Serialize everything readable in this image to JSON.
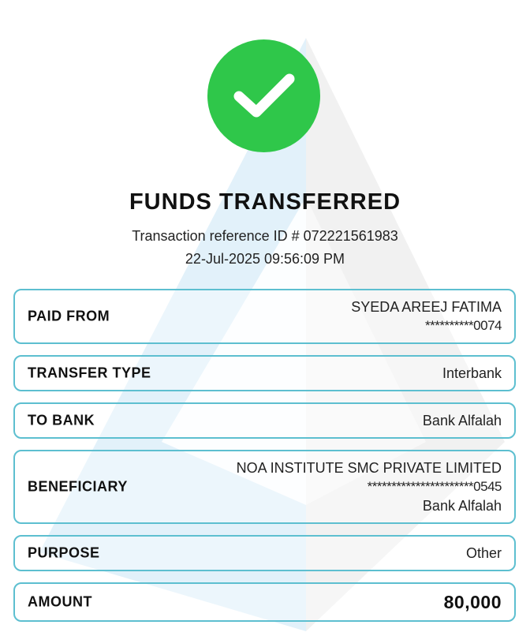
{
  "colors": {
    "success_green": "#2fc74a",
    "border_teal": "#5dbfd0",
    "watermark_blue": "#d6eaf6"
  },
  "icons": {
    "status": "checkmark-icon"
  },
  "header": {
    "title": "FUNDS TRANSFERRED",
    "reference": "Transaction reference ID # 072221561983",
    "datetime": "22-Jul-2025 09:56:09 PM"
  },
  "details": {
    "paid_from": {
      "label": "PAID FROM",
      "name": "SYEDA AREEJ FATIMA",
      "account": "**********0074"
    },
    "transfer_type": {
      "label": "TRANSFER TYPE",
      "value": "Interbank"
    },
    "to_bank": {
      "label": "TO BANK",
      "value": "Bank Alfalah"
    },
    "beneficiary": {
      "label": "BENEFICIARY",
      "name": "NOA INSTITUTE SMC PRIVATE LIMITED",
      "account": "**********************0545",
      "bank": "Bank Alfalah"
    },
    "purpose": {
      "label": "PURPOSE",
      "value": "Other"
    },
    "amount": {
      "label": "AMOUNT",
      "value": "80,000"
    }
  }
}
